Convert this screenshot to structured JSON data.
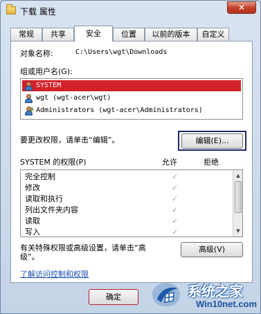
{
  "window": {
    "title": "下载 属性",
    "close_glyph": "✕"
  },
  "tabs": [
    {
      "label": "常规"
    },
    {
      "label": "共享"
    },
    {
      "label": "安全"
    },
    {
      "label": "位置"
    },
    {
      "label": "以前的版本"
    },
    {
      "label": "自定义"
    }
  ],
  "security": {
    "object_name_label": "对象名称:",
    "object_path": "C:\\Users\\wgt\\Downloads",
    "group_label": "组或用户名(G):",
    "users": [
      {
        "name": "SYSTEM",
        "selected": true,
        "icon": "user-icon"
      },
      {
        "name": "wgt (wgt-acer\\wgt)",
        "selected": false,
        "icon": "user-icon"
      },
      {
        "name": "Administrators (wgt-acer\\Administrators)",
        "selected": false,
        "icon": "group-icon"
      }
    ],
    "change_hint": "要更改权限，请单击“编辑”。",
    "edit_button": "编辑(E)...",
    "perm_header": "SYSTEM 的权限(P)",
    "allow_header": "允许",
    "deny_header": "拒绝",
    "permissions": [
      {
        "name": "完全控制",
        "allow": "✓"
      },
      {
        "name": "修改",
        "allow": "✓"
      },
      {
        "name": "读取和执行",
        "allow": "✓"
      },
      {
        "name": "列出文件夹内容",
        "allow": "✓"
      },
      {
        "name": "读取",
        "allow": "✓"
      },
      {
        "name": "写入",
        "allow": "✓"
      }
    ],
    "special_hint_1": "有关特殊权限或高级设置，请单击“高",
    "special_hint_2": "级”。",
    "advanced_button": "高级(V)",
    "learn_link": "了解访问控制和权限"
  },
  "footer": {
    "ok_button": "确定"
  },
  "watermark": {
    "title": "系统之家",
    "site": "Win10net.com"
  },
  "colors": {
    "selection": "#d2212a",
    "link": "#1a4fb5",
    "focus_border": "#1c2a68"
  }
}
